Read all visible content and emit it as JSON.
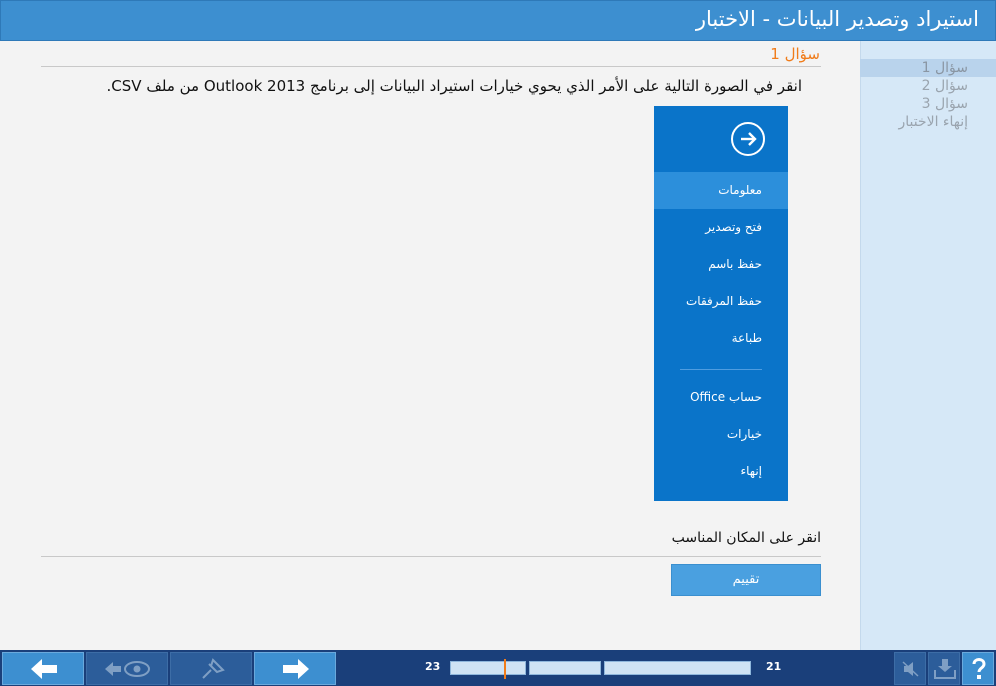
{
  "window": {
    "title": "استيراد وتصدير البيانات - الاختبار"
  },
  "sidebar": {
    "items": [
      {
        "label": "سؤال 1",
        "active": true
      },
      {
        "label": "سؤال 2",
        "active": false
      },
      {
        "label": "سؤال 3",
        "active": false
      },
      {
        "label": "إنهاء الاختبار",
        "active": false
      }
    ]
  },
  "question": {
    "title": "سؤال 1",
    "text": "انقر في الصورة التالية على الأمر الذي يحوي خيارات استيراد البيانات إلى برنامج Outlook 2013 من ملف CSV.",
    "instruction": "انقر على المكان المناسب",
    "evaluate_label": "تقييم"
  },
  "backstage_menu": {
    "back_icon": "arrow-circle-right-icon",
    "items": [
      {
        "label": "معلومات",
        "active": true
      },
      {
        "label": "فتح وتصدير",
        "active": false
      },
      {
        "label": "حفظ باسم",
        "active": false
      },
      {
        "label": "حفظ المرفقات",
        "active": false
      },
      {
        "label": "طباعة",
        "active": false
      },
      {
        "label": "حساب Office",
        "active": false
      },
      {
        "label": "خيارات",
        "active": false
      },
      {
        "label": "إنهاء",
        "active": false
      }
    ]
  },
  "bottom": {
    "left_count": "23",
    "right_count": "21"
  },
  "colors": {
    "accent": "#3d8fd0",
    "menu_blue": "#0a74c9",
    "question_orange": "#f07c1a",
    "bottom_bar": "#1a3f7a"
  }
}
